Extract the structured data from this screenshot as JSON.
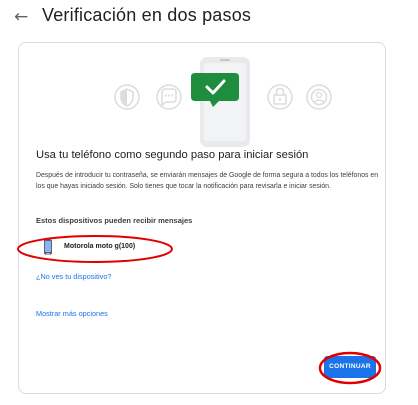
{
  "header": {
    "back_icon": "arrow-back-icon",
    "title": "Verificación en dos pasos"
  },
  "card": {
    "headline": "Usa tu teléfono como segundo paso para iniciar sesión",
    "description": "Después de introducir tu contraseña, se enviarán mensajes de Google de forma segura a todos los teléfonos en los que hayas iniciado sesión. Solo tienes que tocar la notificación para revisarla e iniciar sesión.",
    "devices_label": "Estos dispositivos pueden recibir mensajes",
    "devices": [
      {
        "name": "Motorola moto g(100)",
        "icon": "phone-icon"
      }
    ],
    "no_phone_link": "¿No ves tu dispositivo?",
    "more_options_link": "Mostrar más opciones",
    "continue_label": "CONTINUAR"
  },
  "illustration_icons": [
    "shield-icon",
    "chat-icon",
    "phone-icon",
    "checkmark-bubble-icon",
    "lock-icon",
    "account-icon"
  ],
  "colors": {
    "accent_blue": "#1a73e8",
    "success_green": "#1e8e3e",
    "annotation_red": "#e00000"
  }
}
